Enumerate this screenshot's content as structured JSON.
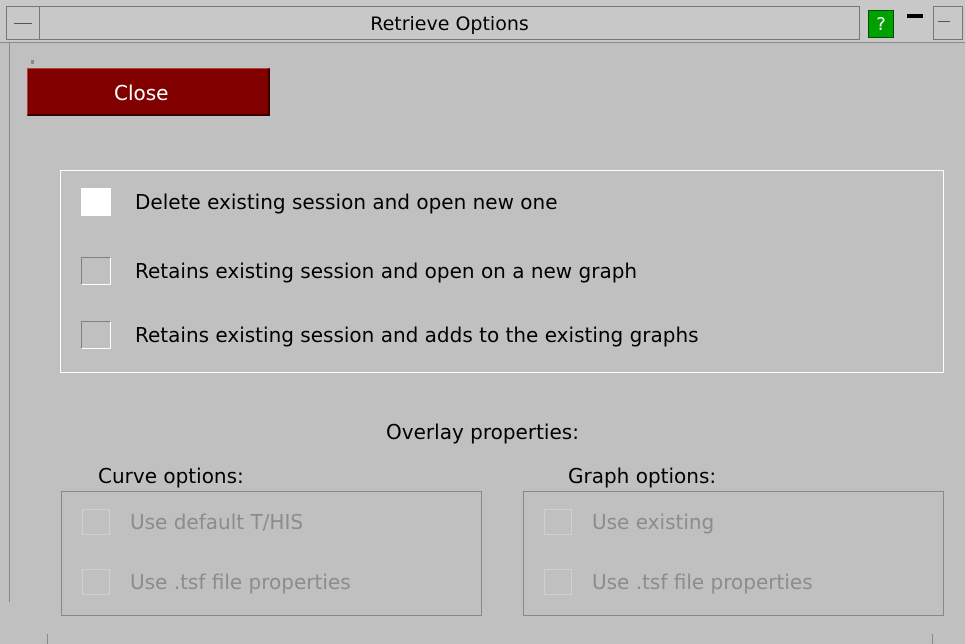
{
  "window": {
    "title": "Retrieve Options",
    "help_label": "?"
  },
  "close_label": "Close",
  "options": [
    {
      "label": "Delete existing session and open new one",
      "checked": true
    },
    {
      "label": "Retains existing session and open on a new graph",
      "checked": false
    },
    {
      "label": "Retains existing session and adds to the existing graphs",
      "checked": false
    }
  ],
  "overlay": {
    "title": "Overlay properties:",
    "curve": {
      "legend": "Curve options:",
      "items": [
        "Use default T/HIS",
        "Use .tsf file properties"
      ]
    },
    "graph": {
      "legend": "Graph options:",
      "items": [
        "Use existing",
        "Use .tsf file properties"
      ]
    }
  },
  "colors": {
    "background": "#c0c0c0",
    "close_button": "#800000",
    "help_button": "#00a000",
    "disabled_text": "#8c8c8c"
  }
}
